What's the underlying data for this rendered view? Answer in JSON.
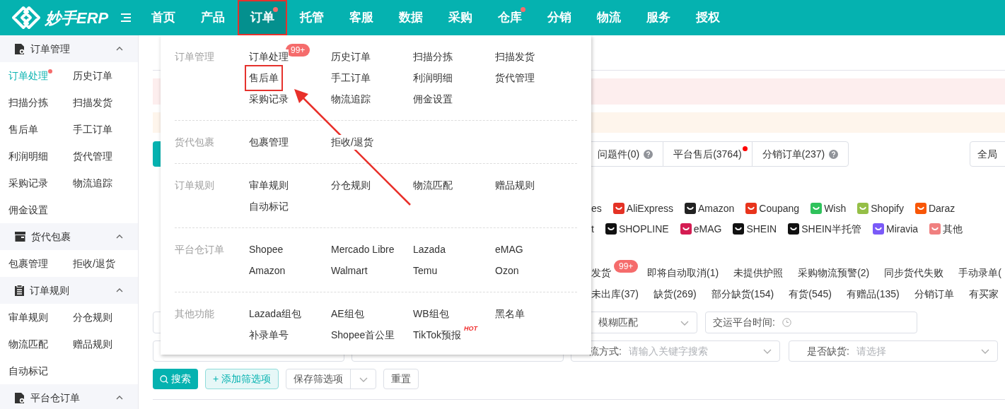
{
  "app": {
    "logo": "妙手ERP"
  },
  "nav": [
    {
      "label": "首页",
      "selected": false,
      "dot": false,
      "highlighted": false
    },
    {
      "label": "产品",
      "selected": false,
      "dot": false,
      "highlighted": false
    },
    {
      "label": "订单",
      "selected": true,
      "dot": true,
      "highlighted": true
    },
    {
      "label": "托管",
      "selected": false,
      "dot": false,
      "highlighted": false
    },
    {
      "label": "客服",
      "selected": false,
      "dot": false,
      "highlighted": false
    },
    {
      "label": "数据",
      "selected": false,
      "dot": false,
      "highlighted": false
    },
    {
      "label": "采购",
      "selected": false,
      "dot": false,
      "highlighted": false
    },
    {
      "label": "仓库",
      "selected": false,
      "dot": true,
      "highlighted": false
    },
    {
      "label": "分销",
      "selected": false,
      "dot": false,
      "highlighted": false
    },
    {
      "label": "物流",
      "selected": false,
      "dot": false,
      "highlighted": false
    },
    {
      "label": "服务",
      "selected": false,
      "dot": false,
      "highlighted": false
    },
    {
      "label": "授权",
      "selected": false,
      "dot": false,
      "highlighted": false
    }
  ],
  "sidebar": {
    "groups": [
      {
        "title": "订单管理",
        "expanded": true,
        "items": [
          {
            "label": "订单处理",
            "selected": true,
            "dot": true
          },
          {
            "label": "历史订单",
            "selected": false,
            "dot": false
          },
          {
            "label": "扫描分拣",
            "selected": false,
            "dot": false
          },
          {
            "label": "扫描发货",
            "selected": false,
            "dot": false
          },
          {
            "label": "售后单",
            "selected": false,
            "dot": false
          },
          {
            "label": "手工订单",
            "selected": false,
            "dot": false
          },
          {
            "label": "利润明细",
            "selected": false,
            "dot": false
          },
          {
            "label": "货代管理",
            "selected": false,
            "dot": false
          },
          {
            "label": "采购记录",
            "selected": false,
            "dot": false
          },
          {
            "label": "物流追踪",
            "selected": false,
            "dot": false
          },
          {
            "label": "佣金设置",
            "selected": false,
            "dot": false
          }
        ]
      },
      {
        "title": "货代包裹",
        "expanded": true,
        "items": [
          {
            "label": "包裹管理",
            "selected": false,
            "dot": false
          },
          {
            "label": "拒收/退货",
            "selected": false,
            "dot": false
          }
        ]
      },
      {
        "title": "订单规则",
        "expanded": true,
        "items": [
          {
            "label": "审单规则",
            "selected": false,
            "dot": false
          },
          {
            "label": "分仓规则",
            "selected": false,
            "dot": false
          },
          {
            "label": "物流匹配",
            "selected": false,
            "dot": false
          },
          {
            "label": "赠品规则",
            "selected": false,
            "dot": false
          },
          {
            "label": "自动标记",
            "selected": false,
            "dot": false
          }
        ]
      },
      {
        "title": "平台仓订单",
        "expanded": true
      }
    ]
  },
  "menu": {
    "sections": [
      {
        "title": "订单管理",
        "items": [
          {
            "label": "订单处理",
            "highlighted": false,
            "badge": {
              "text": "99+",
              "kind": "count"
            }
          },
          {
            "label": "历史订单",
            "highlighted": false
          },
          {
            "label": "扫描分拣",
            "highlighted": false
          },
          {
            "label": "扫描发货",
            "highlighted": false
          },
          {
            "label": "售后单",
            "highlighted": true
          },
          {
            "label": "手工订单",
            "highlighted": false
          },
          {
            "label": "利润明细",
            "highlighted": false
          },
          {
            "label": "货代管理",
            "highlighted": false
          },
          {
            "label": "采购记录",
            "highlighted": false
          },
          {
            "label": "物流追踪",
            "highlighted": false
          },
          {
            "label": "佣金设置",
            "highlighted": false
          }
        ]
      },
      {
        "title": "货代包裹",
        "items": [
          {
            "label": "包裹管理",
            "highlighted": false
          },
          {
            "label": "拒收/退货",
            "highlighted": false
          }
        ]
      },
      {
        "title": "订单规则",
        "items": [
          {
            "label": "审单规则",
            "highlighted": false
          },
          {
            "label": "分仓规则",
            "highlighted": false
          },
          {
            "label": "物流匹配",
            "highlighted": false
          },
          {
            "label": "赠品规则",
            "highlighted": false
          },
          {
            "label": "自动标记",
            "highlighted": false
          }
        ]
      },
      {
        "title": "平台仓订单",
        "items": [
          {
            "label": "Shopee",
            "highlighted": false
          },
          {
            "label": "Mercado Libre",
            "highlighted": false
          },
          {
            "label": "Lazada",
            "highlighted": false
          },
          {
            "label": "eMAG",
            "highlighted": false
          },
          {
            "label": "Amazon",
            "highlighted": false
          },
          {
            "label": "Walmart",
            "highlighted": false
          },
          {
            "label": "Temu",
            "highlighted": false
          },
          {
            "label": "Ozon",
            "highlighted": false
          }
        ]
      },
      {
        "title": "其他功能",
        "items": [
          {
            "label": "Lazada组包",
            "highlighted": false
          },
          {
            "label": "AE组包",
            "highlighted": false
          },
          {
            "label": "WB组包",
            "highlighted": false
          },
          {
            "label": "黑名单",
            "highlighted": false
          },
          {
            "label": "补录单号",
            "highlighted": false
          },
          {
            "label": "Shopee首公里",
            "highlighted": false
          },
          {
            "label": "TikTok预报",
            "highlighted": false,
            "badge": {
              "text": "HOT",
              "kind": "hot"
            }
          }
        ]
      }
    ]
  },
  "page": {
    "tabs": [
      {
        "label": "问题件(0)",
        "help": true,
        "dot": false
      },
      {
        "label": "平台售后(3764)",
        "help": false,
        "dot": true
      },
      {
        "label": "分销订单(237)",
        "help": true,
        "dot": false
      }
    ],
    "scope_button": "全局",
    "platforms": [
      {
        "lead": "es",
        "items": [
          "AliExpress",
          "Amazon",
          "Coupang",
          "Wish",
          "Shopify",
          "Daraz"
        ]
      },
      {
        "lead": "t",
        "items": [
          "SHOPLINE",
          "eMAG",
          "SHEIN",
          "SHEIN半托管",
          "Miravia",
          "其他"
        ]
      }
    ],
    "filters": [
      [
        {
          "label": "发货",
          "badge": "99+"
        },
        {
          "label": "即将自动取消(1)"
        },
        {
          "label": "未提供护照"
        },
        {
          "label": "采购物流预警(2)"
        },
        {
          "label": "同步货代失败"
        },
        {
          "label": "手动录单("
        }
      ],
      [
        {
          "label": "未出库(37)"
        },
        {
          "label": "缺货(269)"
        },
        {
          "label": "部分缺货(154)"
        },
        {
          "label": "有货(545)"
        },
        {
          "label": "有赠品(135)"
        },
        {
          "label": "分销订单"
        },
        {
          "label": "有买家"
        }
      ]
    ],
    "match_select": {
      "value": "模糊匹配"
    },
    "date_field": {
      "label": "交运平台时间:"
    },
    "logistics_field": {
      "label": "流方式:",
      "placeholder": "请输入关键字搜索"
    },
    "stock_field": {
      "label": "是否缺货:",
      "placeholder": "请选择"
    },
    "buttons": [
      {
        "label": "搜索",
        "kind": "primary"
      },
      {
        "label": "+ 添加筛选项",
        "kind": "light"
      },
      {
        "label": "保存筛选项",
        "kind": "split"
      },
      {
        "label": "重置",
        "kind": "plain"
      }
    ]
  }
}
